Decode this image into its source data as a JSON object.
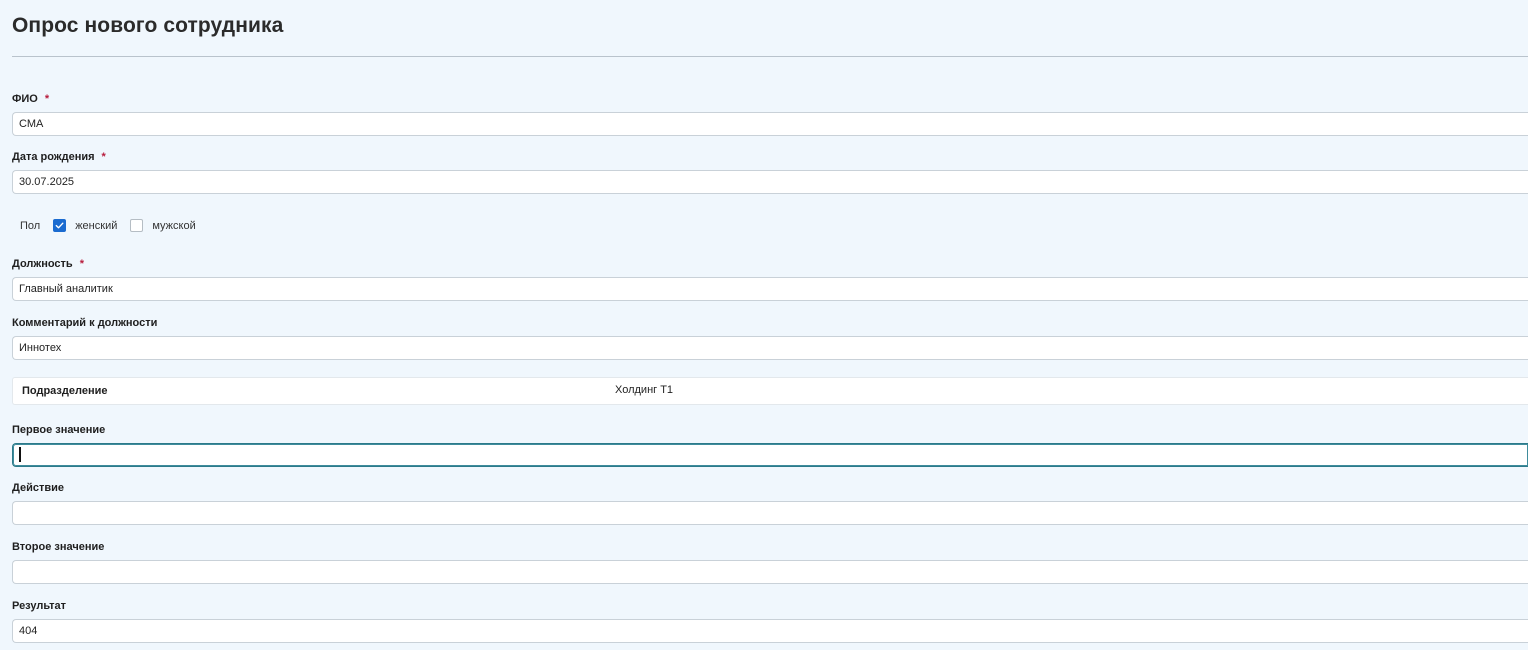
{
  "page": {
    "title": "Опрос нового сотрудника"
  },
  "form": {
    "fio": {
      "label": "ФИО",
      "required_mark": "*",
      "value": "СМА"
    },
    "birth_date": {
      "label": "Дата рождения",
      "required_mark": "*",
      "value": "30.07.2025"
    },
    "gender": {
      "label": "Пол",
      "options": [
        {
          "label": "женский",
          "checked": true
        },
        {
          "label": "мужской",
          "checked": false
        }
      ]
    },
    "position": {
      "label": "Должность",
      "required_mark": "*",
      "value": "Главный аналитик"
    },
    "position_comment": {
      "label": "Комментарий к должности",
      "value": "Иннотех"
    },
    "department": {
      "label": "Подразделение",
      "value": "Холдинг Т1"
    },
    "first_value": {
      "label": "Первое значение",
      "value": ""
    },
    "action": {
      "label": "Действие",
      "value": ""
    },
    "second_value": {
      "label": "Второе значение",
      "value": ""
    },
    "result": {
      "label": "Результат",
      "value": "404"
    }
  },
  "colors": {
    "background": "#f0f7fd",
    "required": "#b71c3c",
    "checkbox_checked": "#1a6bd0",
    "focus_border": "#2c7a8a"
  }
}
